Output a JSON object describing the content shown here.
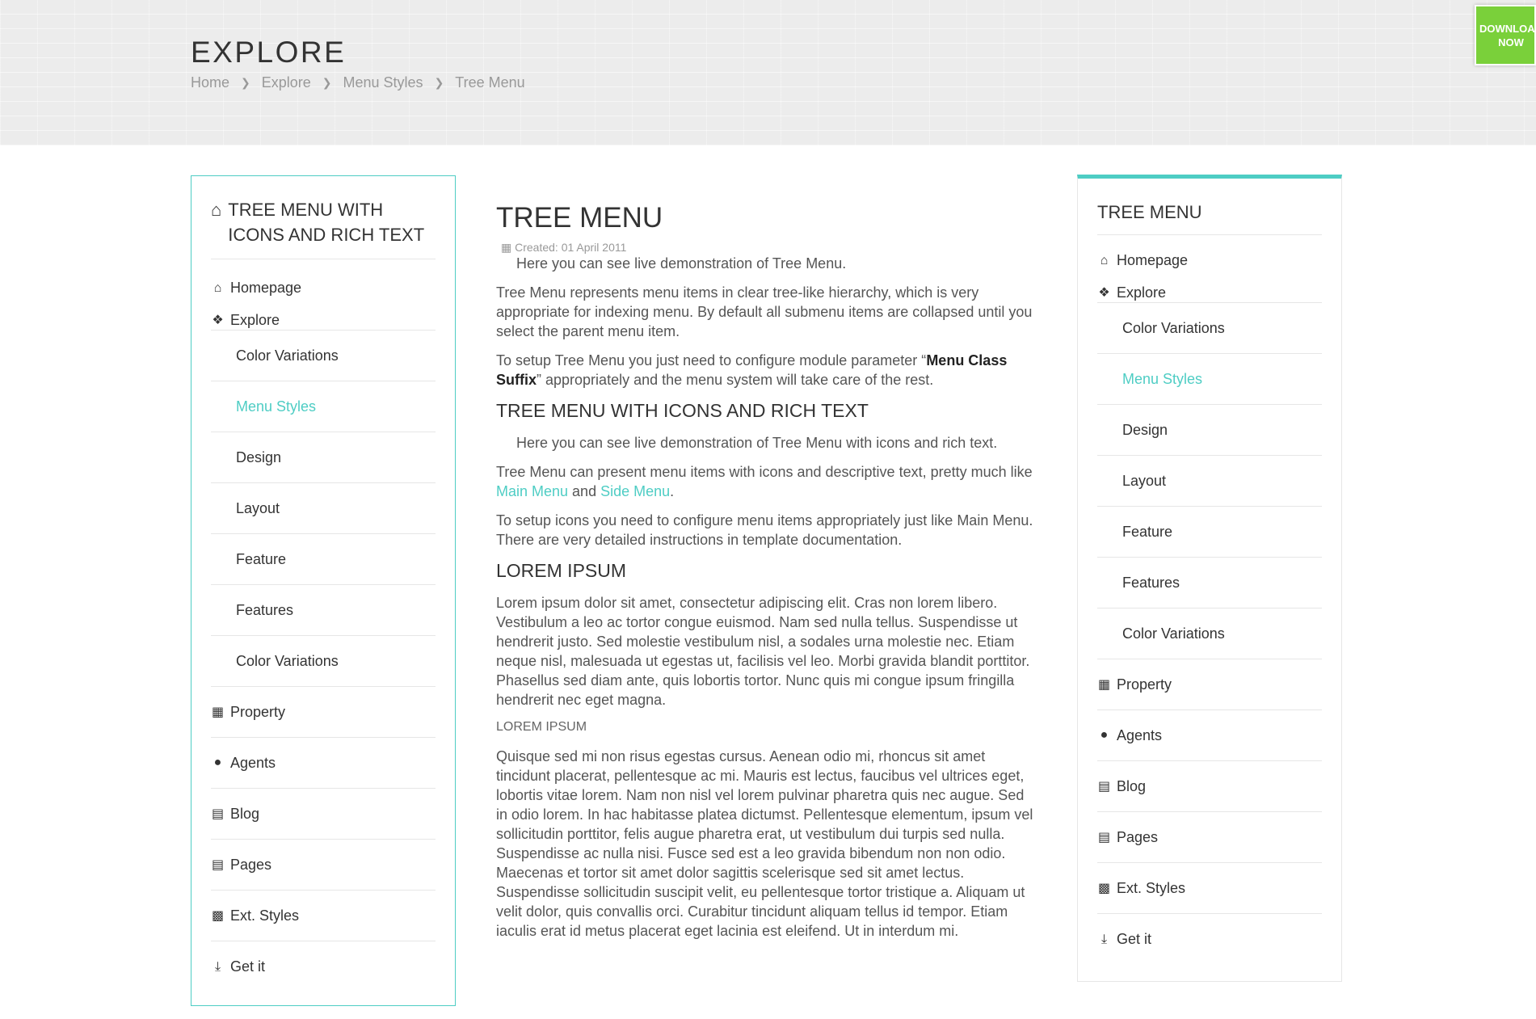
{
  "header": {
    "title": "EXPLORE",
    "breadcrumb": [
      "Home",
      "Explore",
      "Menu Styles",
      "Tree Menu"
    ],
    "download_label_1": "DOWNLOAD",
    "download_label_2": "NOW",
    "download_color": "#7ad03a"
  },
  "left_menu": {
    "title": "TREE MENU WITH ICONS AND RICH TEXT",
    "title_icon": "home-icon",
    "items": {
      "homepage": "Homepage",
      "explore": "Explore",
      "sub": [
        "Color Variations",
        "Menu Styles",
        "Design",
        "Layout",
        "Feature",
        "Features",
        "Color Variations"
      ],
      "property": "Property",
      "agents": "Agents",
      "blog": "Blog",
      "pages": "Pages",
      "ext_styles": "Ext. Styles",
      "get_it": "Get it"
    },
    "active": "Menu Styles"
  },
  "right_menu": {
    "title": "TREE MENU",
    "items": {
      "homepage": "Homepage",
      "explore": "Explore",
      "sub": [
        "Color Variations",
        "Menu Styles",
        "Design",
        "Layout",
        "Feature",
        "Features",
        "Color Variations"
      ],
      "property": "Property",
      "agents": "Agents",
      "blog": "Blog",
      "pages": "Pages",
      "ext_styles": "Ext. Styles",
      "get_it": "Get it"
    },
    "active": "Menu Styles"
  },
  "article": {
    "title": "TREE MENU",
    "created": "Created: 01 April 2011",
    "intro": "Here you can see live demonstration of Tree Menu.",
    "p1": "Tree Menu represents menu items in clear tree-like hierarchy, which is very appropriate for indexing menu. By default all submenu items are collapsed until you select the parent menu item.",
    "p2_pre": "To setup Tree Menu you just need to configure module parameter “",
    "p2_bold": "Menu Class Suffix",
    "p2_post": "” appropriately and the menu system will take care of the rest.",
    "h2_icons": "TREE MENU WITH ICONS AND RICH TEXT",
    "icons_intro": "Here you can see live demonstration of Tree Menu with icons and rich text.",
    "p3_pre": "Tree Menu can present menu items with icons and descriptive text, pretty much like ",
    "p3_link1": "Main Menu",
    "p3_mid": " and ",
    "p3_link2": "Side Menu",
    "p3_post": ".",
    "p4": "To setup icons you need to configure menu items appropriately just like Main Menu. There are very detailed instructions in template documentation.",
    "h2_lorem": "LOREM IPSUM",
    "p5": "Lorem ipsum dolor sit amet, consectetur adipiscing elit. Cras non lorem libero. Vestibulum a leo ac tortor congue euismod. Nam sed nulla tellus. Suspendisse ut hendrerit justo. Sed molestie vestibulum nisl, a sodales urna molestie nec. Etiam neque nisl, malesuada ut egestas ut, facilisis vel leo. Morbi gravida blandit porttitor. Phasellus sed diam ante, quis lobortis tortor. Nunc quis mi congue ipsum fringilla hendrerit nec eget magna.",
    "h4_lorem": "LOREM IPSUM",
    "p6": "Quisque sed mi non risus egestas cursus. Aenean odio mi, rhoncus sit amet tincidunt placerat, pellentesque ac mi. Mauris est lectus, faucibus vel ultrices eget, lobortis vitae lorem. Nam non nisl vel lorem pulvinar pharetra quis nec augue. Sed in odio lorem. In hac habitasse platea dictumst. Pellentesque elementum, ipsum vel sollicitudin porttitor, felis augue pharetra erat, ut vestibulum dui turpis sed nulla. Suspendisse ac nulla nisi. Fusce sed est a leo gravida bibendum non non odio. Maecenas et tortor sit amet dolor sagittis scelerisque sed sit amet lectus. Suspendisse sollicitudin suscipit velit, eu pellentesque tortor tristique a. Aliquam ut velit dolor, quis convallis orci. Curabitur tincidunt aliquam tellus id tempor. Etiam iaculis erat id metus placerat eget lacinia est eleifend. Ut in interdum mi."
  },
  "colors": {
    "accent": "#4ecdc4",
    "download": "#7ad03a"
  }
}
